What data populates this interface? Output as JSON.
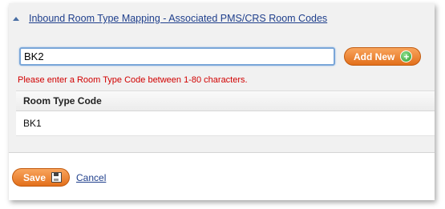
{
  "section": {
    "title": "Inbound Room Type Mapping - Associated PMS/CRS Room Codes",
    "collapse_icon": "collapse-triangle-icon"
  },
  "input": {
    "value": "BK2",
    "placeholder": ""
  },
  "add_button": {
    "label": "Add New",
    "icon": "plus-circle-icon"
  },
  "error": {
    "message": "Please enter a Room Type Code between 1-80 characters."
  },
  "table": {
    "columns": [
      "Room Type Code"
    ],
    "rows": [
      [
        "BK1"
      ]
    ]
  },
  "footer": {
    "save_label": "Save",
    "save_icon": "floppy-disk-icon",
    "cancel_label": "Cancel"
  },
  "colors": {
    "accent_orange": "#e26f1b",
    "link_blue": "#1f3f8c",
    "error_red": "#d10000",
    "plus_green": "#2e9b2e"
  }
}
